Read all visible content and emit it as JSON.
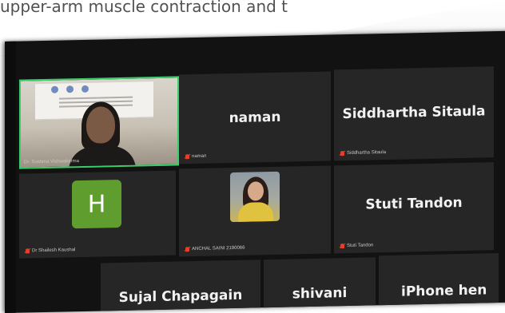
{
  "page": {
    "top_text": "upper-arm muscle contraction and t"
  },
  "meeting": {
    "tiles": [
      {
        "id": "tile-1",
        "label": "Dr. Sushma Vishwakarma",
        "banner": {
          "logos": [
            "logo-1",
            "logo-2",
            "logo-3"
          ]
        },
        "speaking": true
      },
      {
        "id": "tile-2",
        "name": "naman",
        "label": "naman"
      },
      {
        "id": "tile-3",
        "name": "Siddhartha Sitaula",
        "label": "Siddhartha Sitaula"
      },
      {
        "id": "tile-4",
        "avatar_letter": "H",
        "label": "Dr Shailesh Kaushal"
      },
      {
        "id": "tile-5",
        "label": "ANCHAL SAINI 2190066"
      },
      {
        "id": "tile-6",
        "name": "Stuti Tandon",
        "label": "Stuti Tandon"
      },
      {
        "id": "tile-7",
        "name": "Sujal Chapagain"
      },
      {
        "id": "tile-8",
        "name": "shivani"
      },
      {
        "id": "tile-9",
        "name": "iPhone hen"
      }
    ]
  },
  "colors": {
    "background": "#121212",
    "tile": "#262626",
    "active_speaker": "#39d06b",
    "muted_mic": "#e0402e",
    "avatar_green": "#5f9e2e"
  }
}
